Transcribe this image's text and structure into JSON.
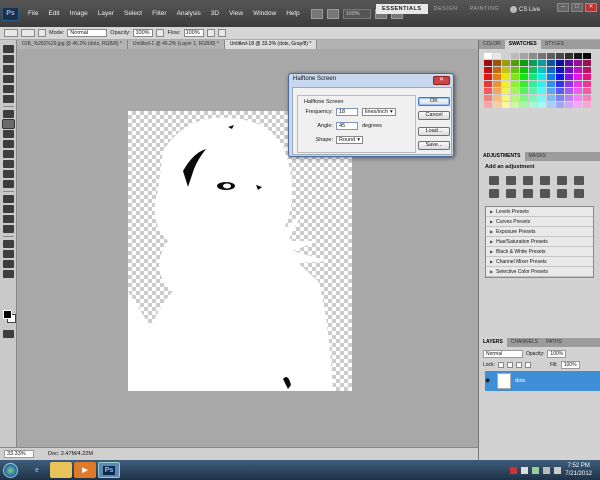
{
  "menubar": {
    "logo": "Ps",
    "items": [
      "File",
      "Edit",
      "Image",
      "Layer",
      "Select",
      "Filter",
      "Analysis",
      "3D",
      "View",
      "Window",
      "Help"
    ],
    "zoom_value": "100%",
    "workspaces": [
      "ESSENTIALS",
      "DESIGN",
      "PAINTING",
      "»"
    ],
    "cslive": "CS Live"
  },
  "options": {
    "mode_label": "Mode:",
    "mode_value": "Normal",
    "opacity_label": "Opacity:",
    "opacity_value": "100%",
    "flow_label": "Flow:",
    "flow_value": "100%"
  },
  "tabs": [
    "01B_%282%29.jpg @ 46.2% (dots, RGB/8) *",
    "Untitled-1 @ 46.2% (Layer 1, RGB/8) *",
    "Untitled-18 @ 33.3% (dots, Gray/8) *"
  ],
  "status": {
    "zoom": "33.33%",
    "doc": "Doc: 2.47M/4.22M"
  },
  "dialog": {
    "title": "Halftone Screen",
    "group": "Halftone Screen",
    "frequency_label": "Frequency:",
    "frequency_value": "18",
    "frequency_unit": "lines/inch",
    "angle_label": "Angle:",
    "angle_value": "45",
    "angle_unit": "degrees",
    "shape_label": "Shape:",
    "shape_value": "Round",
    "buttons": [
      "OK",
      "Cancel",
      "Load...",
      "Save..."
    ]
  },
  "panels": {
    "color_tabs": [
      "COLOR",
      "SWATCHES",
      "STYLES"
    ],
    "adj_tabs": [
      "ADJUSTMENTS",
      "MASKS"
    ],
    "adj_title": "Add an adjustment",
    "presets": [
      "Levels Presets",
      "Curves Presets",
      "Exposure Presets",
      "Hue/Saturation Presets",
      "Black & White Presets",
      "Channel Mixer Presets",
      "Selective Color Presets"
    ],
    "layer_tabs": [
      "LAYERS",
      "CHANNELS",
      "PATHS"
    ],
    "blend_mode": "Normal",
    "opacity_label": "Opacity:",
    "opacity_value": "100%",
    "lock_label": "Lock:",
    "fill_label": "Fill:",
    "fill_value": "100%",
    "layer_name": "dots"
  },
  "taskbar": {
    "ps_label": "Ps",
    "time": "7:52 PM",
    "date": "7/21/2012"
  }
}
